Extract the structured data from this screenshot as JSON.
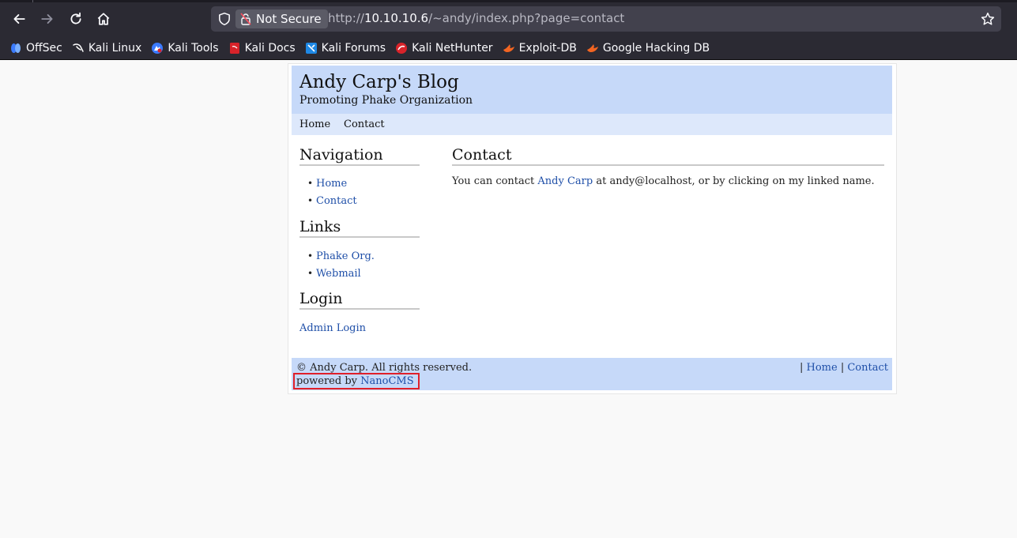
{
  "browser": {
    "nav": {
      "back": "back-icon",
      "forward": "forward-icon",
      "reload": "reload-icon",
      "home": "home-icon"
    },
    "urlbar": {
      "security_label": "Not Secure",
      "url_prefix": "http://",
      "url_host": "10.10.10.6",
      "url_path": "/~andy/index.php?page=contact"
    },
    "bookmarks": [
      {
        "label": "OffSec",
        "icon": "offsec-icon",
        "color": "#3b7bff"
      },
      {
        "label": "Kali Linux",
        "icon": "kali-dragon-icon",
        "color": "#ffffff"
      },
      {
        "label": "Kali Tools",
        "icon": "kali-tools-icon",
        "color": "#3b7bff"
      },
      {
        "label": "Kali Docs",
        "icon": "kali-docs-icon",
        "color": "#d8232a"
      },
      {
        "label": "Kali Forums",
        "icon": "kali-forums-icon",
        "color": "#1e88e5"
      },
      {
        "label": "Kali NetHunter",
        "icon": "nethunter-icon",
        "color": "#d8232a"
      },
      {
        "label": "Exploit-DB",
        "icon": "exploitdb-icon",
        "color": "#f26522"
      },
      {
        "label": "Google Hacking DB",
        "icon": "ghdb-icon",
        "color": "#f26522"
      }
    ]
  },
  "site": {
    "title": "Andy Carp's Blog",
    "subtitle": "Promoting Phake Organization",
    "topnav": [
      "Home",
      "Contact"
    ],
    "sidebar": {
      "navigation_heading": "Navigation",
      "navigation_items": [
        "Home",
        "Contact"
      ],
      "links_heading": "Links",
      "links_items": [
        "Phake Org.",
        "Webmail"
      ],
      "login_heading": "Login",
      "admin_login": "Admin Login"
    },
    "main": {
      "heading": "Contact",
      "text_before": "You can contact ",
      "link": "Andy Carp",
      "text_after": " at andy@localhost, or by clicking on my linked name."
    },
    "footer": {
      "copyright": "© Andy Carp. All rights reserved.",
      "powered_prefix": "powered by ",
      "powered_link": "NanoCMS",
      "sep1": "| ",
      "home": "Home",
      "sep2": " | ",
      "contact": "Contact"
    }
  },
  "colors": {
    "header_bg": "#c6d9f9",
    "topnav_bg": "#dde8fb",
    "link": "#1f4fa8",
    "highlight_box": "#e0202a"
  }
}
